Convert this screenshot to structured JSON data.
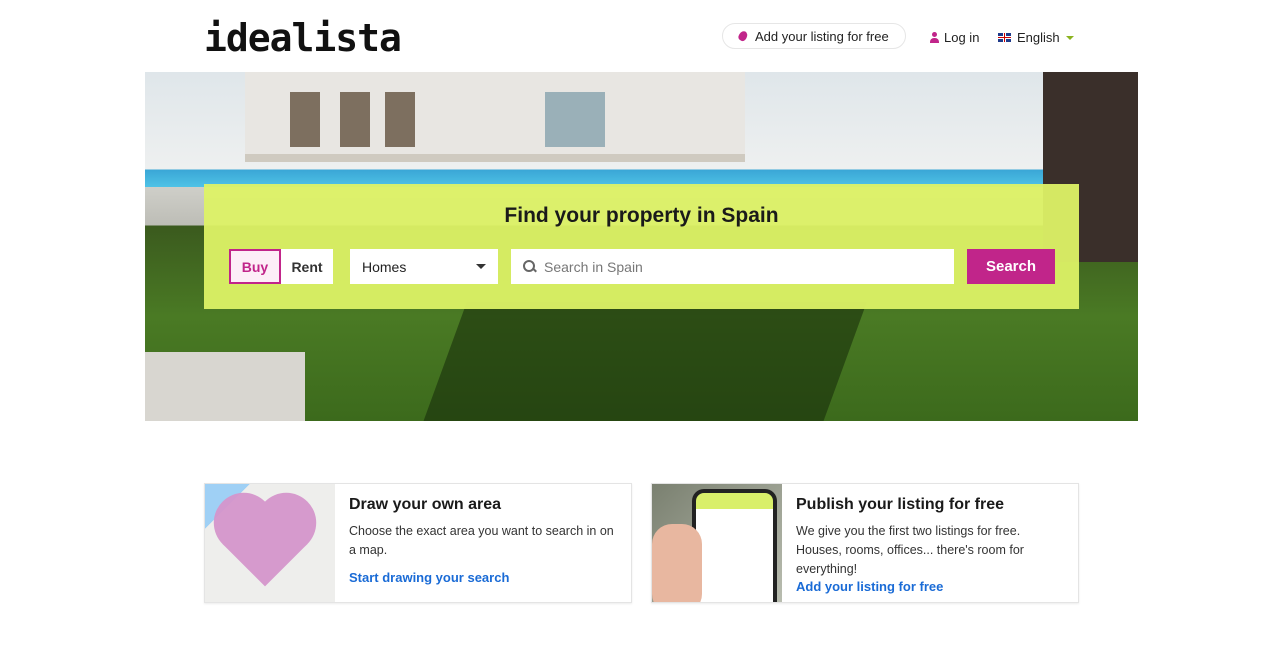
{
  "header": {
    "logo": "idealista",
    "add_listing": "Add your listing for free",
    "login": "Log in",
    "language": "English"
  },
  "colors": {
    "brand": "#c1258a",
    "panel": "#ddf266",
    "link": "#1a6bd6"
  },
  "hero": {
    "title": "Find your property in Spain",
    "tabs": [
      {
        "label": "Buy",
        "active": true
      },
      {
        "label": "Rent",
        "active": false
      }
    ],
    "property_type": "Homes",
    "search_placeholder": "Search in Spain",
    "search_button": "Search"
  },
  "cards": [
    {
      "title": "Draw your own area",
      "text": "Choose the exact area you want to search in on a map.",
      "link": "Start drawing your search"
    },
    {
      "title": "Publish your listing for free",
      "text": "We give you the first two listings for free. Houses, rooms, offices... there's room for everything!",
      "link": "Add your listing for free"
    }
  ]
}
